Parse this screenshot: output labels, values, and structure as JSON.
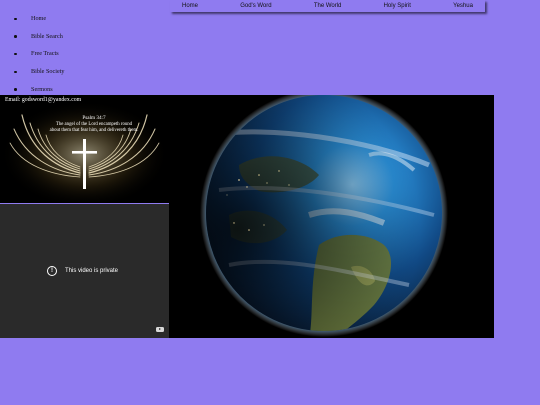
{
  "top_nav": {
    "items": [
      "Home",
      "God's Word",
      "The World",
      "Holy Spirit",
      "Yeshua"
    ]
  },
  "side_menu": {
    "items": [
      "Home",
      "Bible Search",
      "Free Tracts",
      "Bible Society",
      "Sermons"
    ]
  },
  "contact": {
    "email": "Email: godsword1@yandex.com"
  },
  "psalm_card": {
    "reference": "Psalm 34:7",
    "line1": "The angel of the Lord encampeth round",
    "line2": "about them that fear him, and delivereth them."
  },
  "video": {
    "message": "This video is private",
    "info_icon": "info-icon",
    "logo_icon": "youtube-icon"
  },
  "earth_image": {
    "icon": "earth-globe-image"
  },
  "colors": {
    "page_background": "#8f7bf0",
    "panel_black": "#000000",
    "video_gray": "#2a2a2a"
  }
}
